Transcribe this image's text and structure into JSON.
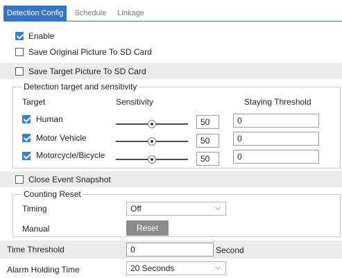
{
  "tabs": [
    {
      "label": "Detection Config",
      "active": true
    },
    {
      "label": "Schedule",
      "active": false
    },
    {
      "label": "Linkage",
      "active": false
    }
  ],
  "enable": {
    "label": "Enable",
    "checked": true
  },
  "save_original": {
    "label": "Save Original Picture To SD Card",
    "checked": false
  },
  "save_target": {
    "label": "Save Target Picture To SD Card",
    "checked": false
  },
  "detection": {
    "legend": "Detection target and sensitivity",
    "col_target": "Target",
    "col_sensitivity": "Sensitivity",
    "col_threshold": "Staying Threshold",
    "targets": [
      {
        "label": "Human",
        "checked": true,
        "sensitivity": "50",
        "threshold": "0"
      },
      {
        "label": "Motor Vehicle",
        "checked": true,
        "sensitivity": "50",
        "threshold": "0"
      },
      {
        "label": "Motorcycle/Bicycle",
        "checked": true,
        "sensitivity": "50",
        "threshold": "0"
      }
    ]
  },
  "close_snapshot": {
    "label": "Close Event Snapshot",
    "checked": false
  },
  "counting": {
    "legend": "Counting Reset",
    "timing_label": "Timing",
    "timing_value": "Off",
    "manual_label": "Manual",
    "reset_label": "Reset"
  },
  "time_threshold": {
    "label": "Time Threshold",
    "value": "0",
    "unit": "Second"
  },
  "alarm_holding": {
    "label": "Alarm Holding Time",
    "value": "20 Seconds"
  },
  "colors": {
    "accent": "#3575c6",
    "checkbox": "#3a7fd5",
    "shaded_row": "#ebebeb",
    "button": "#8b8b8b"
  },
  "icons": {
    "checkbox_checked": "check-icon",
    "dropdown": "chevron-down-icon"
  }
}
